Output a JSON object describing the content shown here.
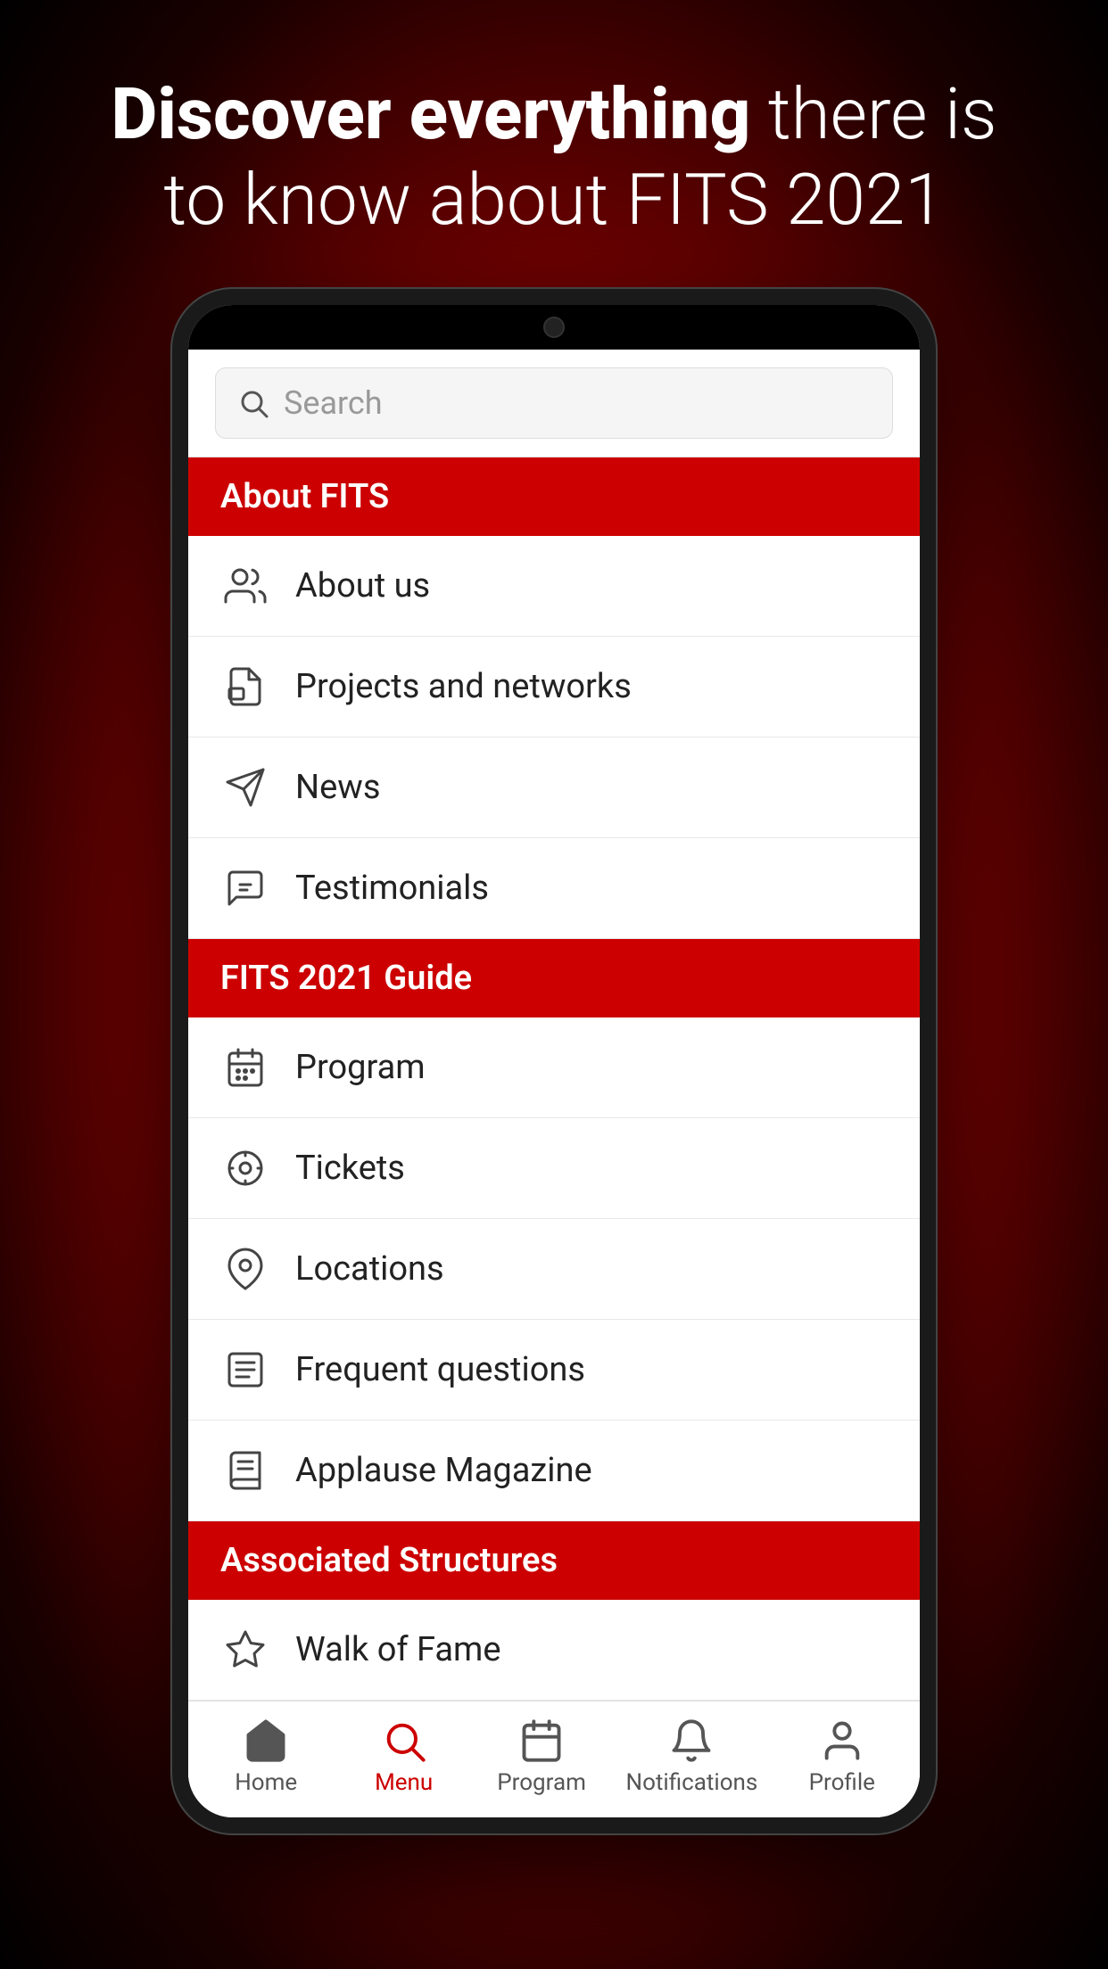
{
  "hero": {
    "line1_bold": "Discover everything",
    "line1_rest": " there is",
    "line2": "to know about FITS 2021"
  },
  "search": {
    "placeholder": "Search"
  },
  "sections": [
    {
      "title": "About FITS",
      "items": [
        {
          "id": "about-us",
          "label": "About us",
          "icon": "people"
        },
        {
          "id": "projects-networks",
          "label": "Projects and networks",
          "icon": "documents"
        },
        {
          "id": "news",
          "label": "News",
          "icon": "send"
        },
        {
          "id": "testimonials",
          "label": "Testimonials",
          "icon": "chat"
        }
      ]
    },
    {
      "title": "FITS 2021 Guide",
      "items": [
        {
          "id": "program",
          "label": "Program",
          "icon": "calendar"
        },
        {
          "id": "tickets",
          "label": "Tickets",
          "icon": "ticket"
        },
        {
          "id": "locations",
          "label": "Locations",
          "icon": "location"
        },
        {
          "id": "faq",
          "label": "Frequent questions",
          "icon": "list"
        },
        {
          "id": "magazine",
          "label": "Applause Magazine",
          "icon": "book"
        }
      ]
    },
    {
      "title": "Associated Structures",
      "items": [
        {
          "id": "walk-of-fame",
          "label": "Walk of Fame",
          "icon": "star"
        }
      ]
    }
  ],
  "bottomNav": [
    {
      "id": "home",
      "label": "Home",
      "icon": "home",
      "active": false
    },
    {
      "id": "menu",
      "label": "Menu",
      "icon": "menu-search",
      "active": true
    },
    {
      "id": "program-nav",
      "label": "Program",
      "icon": "calendar-nav",
      "active": false
    },
    {
      "id": "notifications",
      "label": "Notifications",
      "icon": "bell",
      "active": false
    },
    {
      "id": "profile",
      "label": "Profile",
      "icon": "person",
      "active": false
    }
  ]
}
